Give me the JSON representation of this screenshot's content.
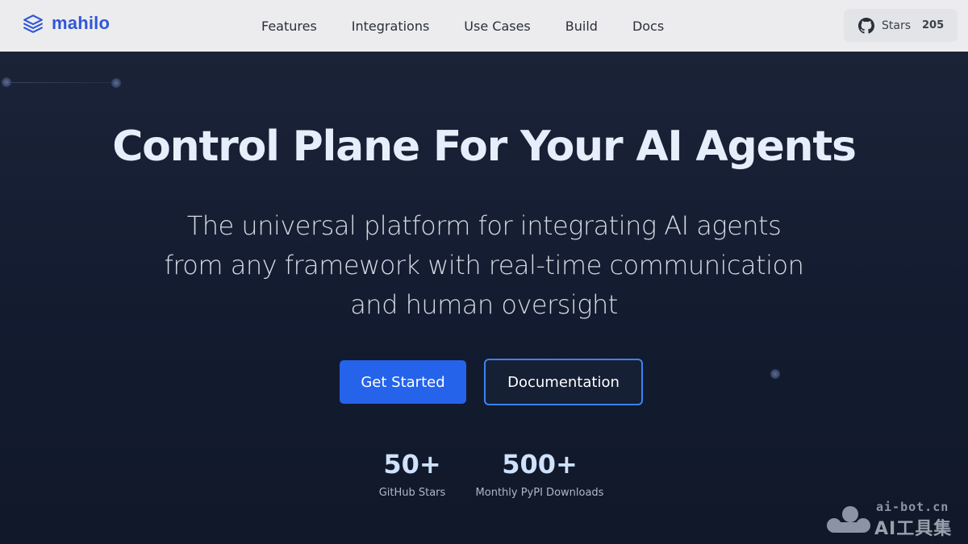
{
  "nav": {
    "brand": "mahilo",
    "links": [
      "Features",
      "Integrations",
      "Use Cases",
      "Build",
      "Docs"
    ],
    "stars_label": "Stars",
    "stars_count": "205",
    "brand_icon": "layers-icon",
    "github_icon": "github-icon"
  },
  "hero": {
    "title": "Control Plane For Your AI Agents",
    "subtitle": "The universal platform for integrating AI agents from any framework with real-time communication and human oversight",
    "primary_button": "Get Started",
    "secondary_button": "Documentation",
    "stats": [
      {
        "value": "50+",
        "label": "GitHub Stars"
      },
      {
        "value": "500+",
        "label": "Monthly PyPI Downloads"
      }
    ]
  },
  "watermark": {
    "url": "ai-bot.cn",
    "name": "AI工具集"
  },
  "colors": {
    "brand": "#2f57d8",
    "primary_button": "#2563eb",
    "hero_background": "#141d31",
    "nav_background": "#ececee"
  }
}
